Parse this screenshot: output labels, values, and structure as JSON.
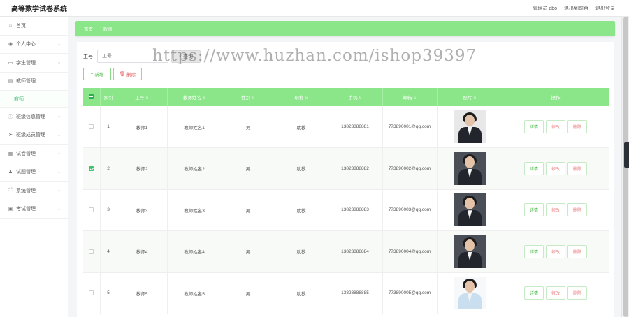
{
  "app": {
    "title": "高等数学试卷系统"
  },
  "header": {
    "links": [
      "管理员 abo",
      "退出到前台",
      "退出登录"
    ]
  },
  "sidebar": {
    "items": [
      {
        "label": "首页",
        "icon": "home-icon",
        "glyph": "⌂",
        "chevron": false
      },
      {
        "label": "个人中心",
        "icon": "user-icon",
        "glyph": "◉",
        "chevron": true
      },
      {
        "label": "学生管理",
        "icon": "id-card-icon",
        "glyph": "▭",
        "chevron": true
      },
      {
        "label": "教师管理",
        "icon": "document-icon",
        "glyph": "▤",
        "chevron": true,
        "expanded": true,
        "children": [
          "教师"
        ]
      },
      {
        "label": "班级信息管理",
        "icon": "info-icon",
        "glyph": "ⓘ",
        "chevron": true
      },
      {
        "label": "班级成员管理",
        "icon": "send-icon",
        "glyph": "➤",
        "chevron": true
      },
      {
        "label": "试卷管理",
        "icon": "grid-icon",
        "glyph": "▦",
        "chevron": true
      },
      {
        "label": "试题管理",
        "icon": "person-icon",
        "glyph": "♟",
        "chevron": true
      },
      {
        "label": "系统管理",
        "icon": "expand-icon",
        "glyph": "⛶",
        "chevron": true
      },
      {
        "label": "考试管理",
        "icon": "folder-icon",
        "glyph": "▣",
        "chevron": true
      }
    ]
  },
  "breadcrumb": {
    "home": "首页",
    "separator": "→",
    "current": "教师"
  },
  "search": {
    "label": "工号",
    "placeholder": "工号",
    "button": "查询",
    "button_icon": "search-icon"
  },
  "actions": {
    "add": "新增",
    "delete": "删除"
  },
  "watermark": "https://www.huzhan.com/ishop39397",
  "table": {
    "headers": [
      "索引",
      "工号",
      "教师姓名",
      "性别",
      "职称",
      "手机",
      "邮箱",
      "照片",
      "操作"
    ],
    "ops": {
      "detail": "详情",
      "edit": "修改",
      "delete": "删除"
    },
    "rows": [
      {
        "index": "1",
        "id": "教师1",
        "name": "教师姓名1",
        "gender": "男",
        "title": "助教",
        "phone": "13823888881",
        "email": "773890001@qq.com",
        "checked": false,
        "photo_style": "bg-light"
      },
      {
        "index": "2",
        "id": "教师2",
        "name": "教师姓名2",
        "gender": "男",
        "title": "助教",
        "phone": "13823888882",
        "email": "773890002@qq.com",
        "checked": true,
        "photo_style": "bg-dark"
      },
      {
        "index": "3",
        "id": "教师3",
        "name": "教师姓名3",
        "gender": "男",
        "title": "助教",
        "phone": "13823888883",
        "email": "773890003@qq.com",
        "checked": false,
        "photo_style": "bg-dark"
      },
      {
        "index": "4",
        "id": "教师4",
        "name": "教师姓名4",
        "gender": "男",
        "title": "助教",
        "phone": "13823888884",
        "email": "773890004@qq.com",
        "checked": false,
        "photo_style": "bg-dark"
      },
      {
        "index": "5",
        "id": "教师5",
        "name": "教师姓名5",
        "gender": "男",
        "title": "助教",
        "phone": "13823888885",
        "email": "773890005@qq.com",
        "checked": false,
        "photo_style": "bg-white"
      }
    ]
  },
  "colors": {
    "accent": "#8ae688",
    "checkbox": "#3fc16a",
    "danger": "#e87979"
  }
}
